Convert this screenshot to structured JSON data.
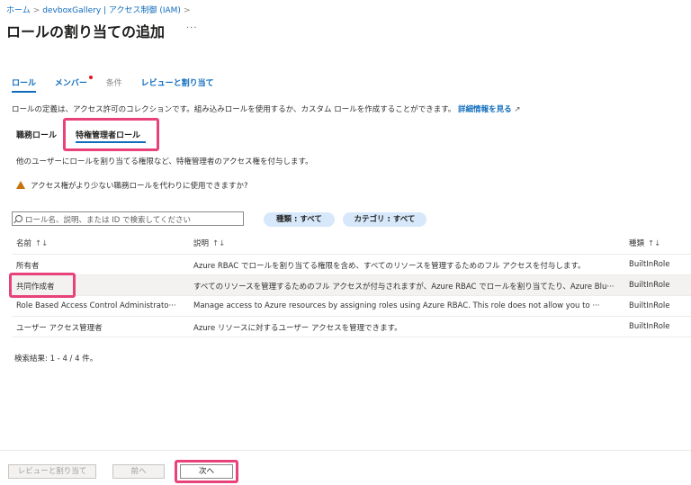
{
  "breadcrumb": {
    "home": "ホーム",
    "current": "devboxGallery | アクセス制御 (IAM)",
    "sep1": ">",
    "sep2": ">"
  },
  "page": {
    "title": "ロールの割り当ての追加",
    "more": "···"
  },
  "tabs": [
    {
      "label": "ロール"
    },
    {
      "label": "メンバー"
    },
    {
      "label": "条件"
    },
    {
      "label": "レビューと割り当て"
    }
  ],
  "description": {
    "text": "ロールの定義は、アクセス許可のコレクションです。組み込みロールを使用するか、カスタム ロールを作成することができます。",
    "link": "詳細情報を見る"
  },
  "subtabs": {
    "job": "職務ロール",
    "privileged": "特権管理者ロール"
  },
  "info": "他のユーザーにロールを割り当てる権限など、特権管理者のアクセス権を付与します。",
  "warning": "アクセス権がより少ない職務ロールを代わりに使用できますか?",
  "search": {
    "placeholder": "ロール名、説明、または ID で検索してください"
  },
  "filters": {
    "type": "種類 : すべて",
    "category": "カテゴリ : すべて"
  },
  "table": {
    "headers": {
      "name": "名前",
      "description": "説明",
      "type": "種類",
      "sort": "↑↓"
    },
    "rows": [
      {
        "name": "所有者",
        "description": "Azure RBAC でロールを割り当てる権限を含め、すべてのリソースを管理するためのフル アクセスを付与します。",
        "type": "BuiltInRole"
      },
      {
        "name": "共同作成者",
        "description": "すべてのリソースを管理するためのフル アクセスが付与されますが、Azure RBAC でロールを割り当てたり、Azure Blu···",
        "type": "BuiltInRole"
      },
      {
        "name": "Role Based Access Control Administrato···",
        "description": "Manage access to Azure resources by assigning roles using Azure RBAC. This role does not allow you to ···",
        "type": "BuiltInRole"
      },
      {
        "name": "ユーザー アクセス管理者",
        "description": "Azure リソースに対するユーザー アクセスを管理できます。",
        "type": "BuiltInRole"
      }
    ]
  },
  "results": "検索結果: 1 - 4 / 4 件。",
  "footer": {
    "review": "レビューと割り当て",
    "prev": "前へ",
    "next": "次へ"
  },
  "colors": {
    "accent": "#0f6cbd",
    "highlight": "#e8427b",
    "pill": "#d6e8fa",
    "warning": "#c7720b"
  }
}
